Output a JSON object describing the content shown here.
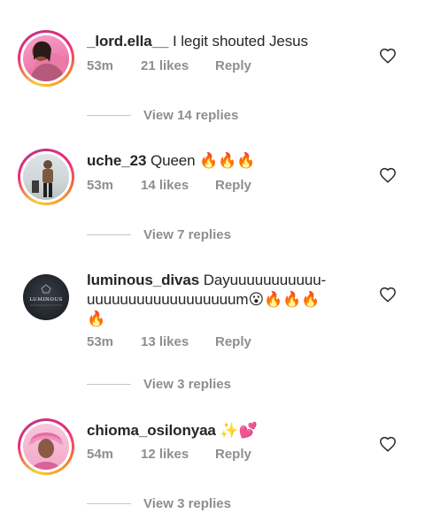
{
  "comments": [
    {
      "username": "_lord.ella__",
      "text": "I legit shouted Jesus",
      "time": "53m",
      "likes": "21 likes",
      "reply": "Reply",
      "view_replies": "View 14 replies",
      "avatar": "avatar-woman-pink-bg"
    },
    {
      "username": "uche_23",
      "text": "Queen 🔥🔥🔥",
      "time": "53m",
      "likes": "14 likes",
      "reply": "Reply",
      "view_replies": "View 7 replies",
      "avatar": "avatar-man-standing"
    },
    {
      "username": "luminous_divas",
      "text": "Dayuuuuuuuuuuu-",
      "text_line2": "uuuuuuuuuuuuuuuuuum😮🔥🔥🔥",
      "text_line3": "🔥",
      "time": "53m",
      "likes": "13 likes",
      "reply": "Reply",
      "view_replies": "View 3 replies",
      "avatar": "avatar-luminous-logo",
      "avatar_logo_text": "LUMINOUS"
    },
    {
      "username": "chioma_osilonyaa",
      "text": "✨💕",
      "time": "54m",
      "likes": "12 likes",
      "reply": "Reply",
      "view_replies": "View 3 replies",
      "avatar": "avatar-woman-pink-gele"
    }
  ],
  "colors": {
    "text": "#262626",
    "secondary": "#8e8e8e",
    "divider": "#c7c7c7",
    "fire": "#f26b1d"
  },
  "icons": {
    "like": "heart-outline-icon"
  }
}
